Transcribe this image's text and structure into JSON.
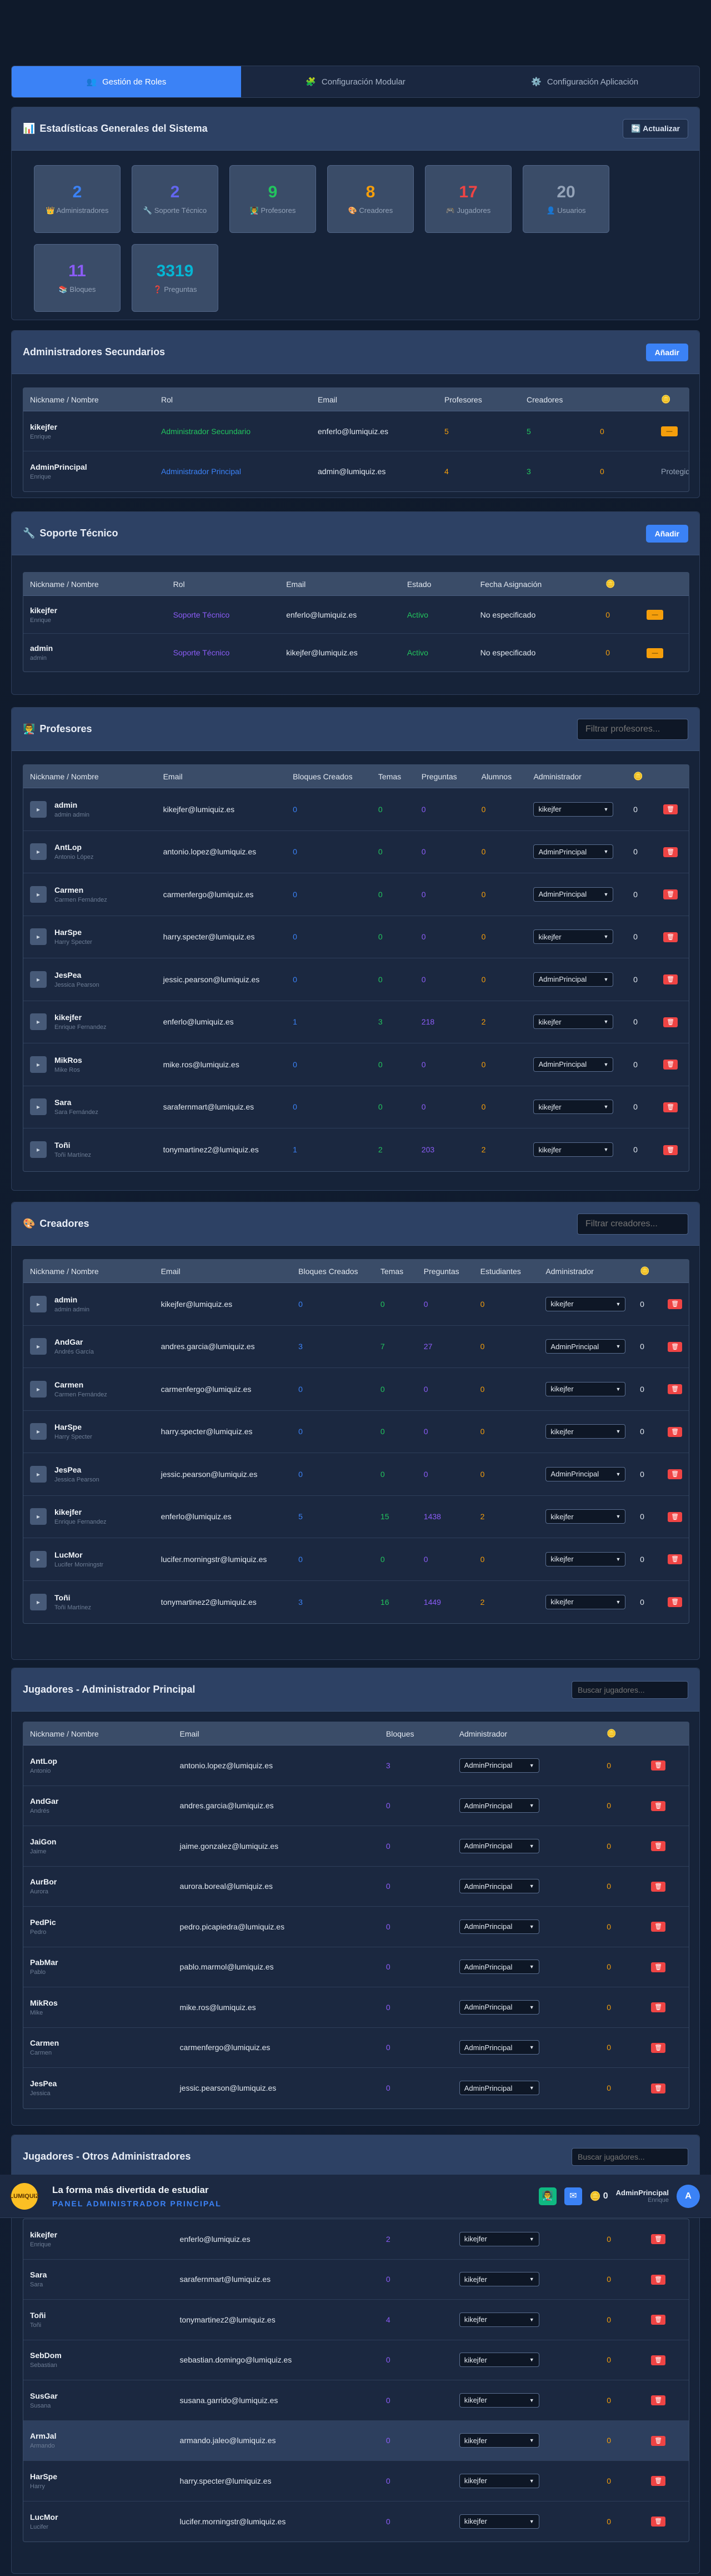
{
  "tabs": [
    {
      "label": "Gestión de Roles",
      "icon": "users-icon"
    },
    {
      "label": "Configuración Modular",
      "icon": "puzzle-icon"
    },
    {
      "label": "Configuración Aplicación",
      "icon": "gear-icon"
    }
  ],
  "stats_section": {
    "title": "Estadísticas Generales del Sistema",
    "refresh": "Actualizar",
    "items": [
      {
        "value": "2",
        "label": "Administradores",
        "color": "#3b82f6",
        "icon": "👑"
      },
      {
        "value": "2",
        "label": "Soporte Técnico",
        "color": "#6366f1",
        "icon": "🔧"
      },
      {
        "value": "9",
        "label": "Profesores",
        "color": "#22c55e",
        "icon": "👨‍🏫"
      },
      {
        "value": "8",
        "label": "Creadores",
        "color": "#f59e0b",
        "icon": "🎨"
      },
      {
        "value": "17",
        "label": "Jugadores",
        "color": "#ef4444",
        "icon": "🎮"
      },
      {
        "value": "20",
        "label": "Usuarios",
        "color": "#94a3b8",
        "icon": "👤"
      },
      {
        "value": "11",
        "label": "Bloques",
        "color": "#8b5cf6",
        "icon": "📚"
      },
      {
        "value": "3319",
        "label": "Preguntas",
        "color": "#06b6d4",
        "icon": "❓"
      }
    ]
  },
  "admins": {
    "title": "Administradores Secundarios",
    "add": "Añadir",
    "headers": [
      "Nickname / Nombre",
      "Rol",
      "Email",
      "Profesores",
      "Creadores",
      "",
      "🪙"
    ],
    "rows": [
      {
        "nick": "kikejfer",
        "name": "Enrique",
        "role": "Administrador Secundario",
        "email": "enferlo@lumiquiz.es",
        "prof": "5",
        "crea": "5",
        "coins": "0",
        "action": "—"
      },
      {
        "nick": "AdminPrincipal",
        "name": "Enrique",
        "role": "Administrador Principal",
        "email": "admin@lumiquiz.es",
        "prof": "4",
        "crea": "3",
        "coins": "0",
        "action": "Protegido"
      }
    ]
  },
  "support": {
    "title": "Soporte Técnico",
    "add": "Añadir",
    "headers": [
      "Nickname / Nombre",
      "Rol",
      "Email",
      "Estado",
      "Fecha Asignación",
      "🪙",
      ""
    ],
    "rows": [
      {
        "nick": "kikejfer",
        "name": "Enrique",
        "role": "Soporte Técnico",
        "email": "enferlo@lumiquiz.es",
        "estado": "Activo",
        "fecha": "No especificado",
        "coins": "0"
      },
      {
        "nick": "admin",
        "name": "admin",
        "role": "Soporte Técnico",
        "email": "kikejfer@lumiquiz.es",
        "estado": "Activo",
        "fecha": "No especificado",
        "coins": "0"
      }
    ]
  },
  "profesores": {
    "title": "Profesores",
    "filter": "Filtrar profesores...",
    "headers": [
      "Nickname / Nombre",
      "Email",
      "Bloques Creados",
      "Temas",
      "Preguntas",
      "Alumnos",
      "Administrador",
      "🪙",
      ""
    ],
    "rows": [
      {
        "nick": "admin",
        "name": "admin admin",
        "email": "kikejfer@lumiquiz.es",
        "b": "0",
        "t": "0",
        "p": "0",
        "a": "0",
        "adm": "kikejfer",
        "coins": "0"
      },
      {
        "nick": "AntLop",
        "name": "Antonio López",
        "email": "antonio.lopez@lumiquiz.es",
        "b": "0",
        "t": "0",
        "p": "0",
        "a": "0",
        "adm": "AdminPrincipal",
        "coins": "0"
      },
      {
        "nick": "Carmen",
        "name": "Carmen Fernández",
        "email": "carmenfergo@lumiquiz.es",
        "b": "0",
        "t": "0",
        "p": "0",
        "a": "0",
        "adm": "AdminPrincipal",
        "coins": "0"
      },
      {
        "nick": "HarSpe",
        "name": "Harry Specter",
        "email": "harry.specter@lumiquiz.es",
        "b": "0",
        "t": "0",
        "p": "0",
        "a": "0",
        "adm": "kikejfer",
        "coins": "0"
      },
      {
        "nick": "JesPea",
        "name": "Jessica Pearson",
        "email": "jessic.pearson@lumiquiz.es",
        "b": "0",
        "t": "0",
        "p": "0",
        "a": "0",
        "adm": "AdminPrincipal",
        "coins": "0"
      },
      {
        "nick": "kikejfer",
        "name": "Enrique Fernandez",
        "email": "enferlo@lumiquiz.es",
        "b": "1",
        "t": "3",
        "p": "218",
        "a": "2",
        "adm": "kikejfer",
        "coins": "0"
      },
      {
        "nick": "MikRos",
        "name": "Mike Ros",
        "email": "mike.ros@lumiquiz.es",
        "b": "0",
        "t": "0",
        "p": "0",
        "a": "0",
        "adm": "AdminPrincipal",
        "coins": "0"
      },
      {
        "nick": "Sara",
        "name": "Sara Fernández",
        "email": "sarafernmart@lumiquiz.es",
        "b": "0",
        "t": "0",
        "p": "0",
        "a": "0",
        "adm": "kikejfer",
        "coins": "0"
      },
      {
        "nick": "Toñi",
        "name": "Toñi Martínez",
        "email": "tonymartinez2@lumiquiz.es",
        "b": "1",
        "t": "2",
        "p": "203",
        "a": "2",
        "adm": "kikejfer",
        "coins": "0"
      }
    ]
  },
  "creadores": {
    "title": "Creadores",
    "filter": "Filtrar creadores...",
    "headers": [
      "Nickname / Nombre",
      "Email",
      "Bloques Creados",
      "Temas",
      "Preguntas",
      "Estudiantes",
      "Administrador",
      "🪙",
      ""
    ],
    "rows": [
      {
        "nick": "admin",
        "name": "admin admin",
        "email": "kikejfer@lumiquiz.es",
        "b": "0",
        "t": "0",
        "p": "0",
        "a": "0",
        "adm": "kikejfer",
        "coins": "0"
      },
      {
        "nick": "AndGar",
        "name": "Andrés García",
        "email": "andres.garcia@lumiquiz.es",
        "b": "3",
        "t": "7",
        "p": "27",
        "a": "0",
        "adm": "AdminPrincipal",
        "coins": "0"
      },
      {
        "nick": "Carmen",
        "name": "Carmen Fernández",
        "email": "carmenfergo@lumiquiz.es",
        "b": "0",
        "t": "0",
        "p": "0",
        "a": "0",
        "adm": "kikejfer",
        "coins": "0"
      },
      {
        "nick": "HarSpe",
        "name": "Harry Specter",
        "email": "harry.specter@lumiquiz.es",
        "b": "0",
        "t": "0",
        "p": "0",
        "a": "0",
        "adm": "kikejfer",
        "coins": "0"
      },
      {
        "nick": "JesPea",
        "name": "Jessica Pearson",
        "email": "jessic.pearson@lumiquiz.es",
        "b": "0",
        "t": "0",
        "p": "0",
        "a": "0",
        "adm": "AdminPrincipal",
        "coins": "0"
      },
      {
        "nick": "kikejfer",
        "name": "Enrique Fernandez",
        "email": "enferlo@lumiquiz.es",
        "b": "5",
        "t": "15",
        "p": "1438",
        "a": "2",
        "adm": "kikejfer",
        "coins": "0"
      },
      {
        "nick": "LucMor",
        "name": "Lucifer Morningstr",
        "email": "lucifer.morningstr@lumiquiz.es",
        "b": "0",
        "t": "0",
        "p": "0",
        "a": "0",
        "adm": "kikejfer",
        "coins": "0"
      },
      {
        "nick": "Toñi",
        "name": "Toñi Martínez",
        "email": "tonymartinez2@lumiquiz.es",
        "b": "3",
        "t": "16",
        "p": "1449",
        "a": "2",
        "adm": "kikejfer",
        "coins": "0"
      }
    ]
  },
  "jugadores_principal": {
    "title": "Jugadores - Administrador Principal",
    "search": "Buscar jugadores...",
    "headers": [
      "Nickname / Nombre",
      "Email",
      "Bloques",
      "Administrador",
      "🪙",
      ""
    ],
    "rows": [
      {
        "nick": "AntLop",
        "name": "Antonio",
        "email": "antonio.lopez@lumiquiz.es",
        "b": "3",
        "adm": "AdminPrincipal",
        "coins": "0"
      },
      {
        "nick": "AndGar",
        "name": "Andrés",
        "email": "andres.garcia@lumiquiz.es",
        "b": "0",
        "adm": "AdminPrincipal",
        "coins": "0"
      },
      {
        "nick": "JaiGon",
        "name": "Jaime",
        "email": "jaime.gonzalez@lumiquiz.es",
        "b": "0",
        "adm": "AdminPrincipal",
        "coins": "0"
      },
      {
        "nick": "AurBor",
        "name": "Aurora",
        "email": "aurora.boreal@lumiquiz.es",
        "b": "0",
        "adm": "AdminPrincipal",
        "coins": "0"
      },
      {
        "nick": "PedPic",
        "name": "Pedro",
        "email": "pedro.picapiedra@lumiquiz.es",
        "b": "0",
        "adm": "AdminPrincipal",
        "coins": "0"
      },
      {
        "nick": "PabMar",
        "name": "Pablo",
        "email": "pablo.marmol@lumiquiz.es",
        "b": "0",
        "adm": "AdminPrincipal",
        "coins": "0"
      },
      {
        "nick": "MikRos",
        "name": "Mike",
        "email": "mike.ros@lumiquiz.es",
        "b": "0",
        "adm": "AdminPrincipal",
        "coins": "0"
      },
      {
        "nick": "Carmen",
        "name": "Carmen",
        "email": "carmenfergo@lumiquiz.es",
        "b": "0",
        "adm": "AdminPrincipal",
        "coins": "0"
      },
      {
        "nick": "JesPea",
        "name": "Jessica",
        "email": "jessic.pearson@lumiquiz.es",
        "b": "0",
        "adm": "AdminPrincipal",
        "coins": "0"
      }
    ]
  },
  "jugadores_otros": {
    "title": "Jugadores - Otros Administradores",
    "search": "Buscar jugadores...",
    "rows": [
      {
        "nick": "kikejfer",
        "name": "Enrique",
        "email": "enferlo@lumiquiz.es",
        "b": "2",
        "adm": "kikejfer",
        "coins": "0"
      },
      {
        "nick": "Sara",
        "name": "Sara",
        "email": "sarafernmart@lumiquiz.es",
        "b": "0",
        "adm": "kikejfer",
        "coins": "0"
      },
      {
        "nick": "Toñi",
        "name": "Toñi",
        "email": "tonymartinez2@lumiquiz.es",
        "b": "4",
        "adm": "kikejfer",
        "coins": "0"
      },
      {
        "nick": "SebDom",
        "name": "Sebastian",
        "email": "sebastian.domingo@lumiquiz.es",
        "b": "0",
        "adm": "kikejfer",
        "coins": "0"
      },
      {
        "nick": "SusGar",
        "name": "Susana",
        "email": "susana.garrido@lumiquiz.es",
        "b": "0",
        "adm": "kikejfer",
        "coins": "0"
      },
      {
        "nick": "ArmJal",
        "name": "Armando",
        "email": "armando.jaleo@lumiquiz.es",
        "b": "0",
        "adm": "kikejfer",
        "coins": "0"
      },
      {
        "nick": "HarSpe",
        "name": "Harry",
        "email": "harry.specter@lumiquiz.es",
        "b": "0",
        "adm": "kikejfer",
        "coins": "0"
      },
      {
        "nick": "LucMor",
        "name": "Lucifer",
        "email": "lucifer.morningstr@lumiquiz.es",
        "b": "0",
        "adm": "kikejfer",
        "coins": "0"
      }
    ]
  },
  "topbar": {
    "logo": "LUMIQUIZ",
    "tagline": "La forma más divertida de estudiar",
    "panel": "PANEL ADMINISTRADOR PRINCIPAL",
    "coins": "0",
    "user": "AdminPrincipal",
    "user_sub": "Enrique",
    "avatar": "A"
  }
}
